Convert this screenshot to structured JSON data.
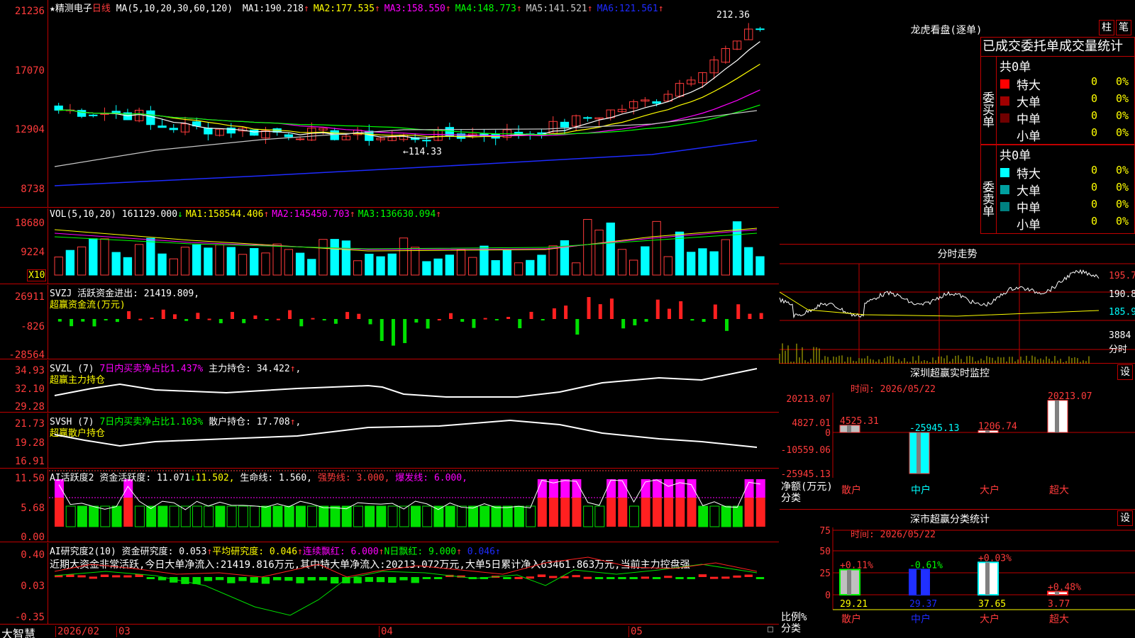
{
  "app": {
    "brand": "大智慧",
    "title": "精测电子",
    "period": "日线",
    "title_star": "★"
  },
  "colors": {
    "red": "#ff3b3b",
    "cyan": "#00ffff",
    "green": "#00ff00",
    "yellow": "#ffff00",
    "magenta": "#ff00ff",
    "blue": "#1e2bff",
    "grid": "#c00000",
    "white": "#ffffff"
  },
  "main": {
    "ma_label": "MA(5,10,20,30,60,120)",
    "ma": [
      {
        "name": "MA1:",
        "value": "190.218",
        "arrow": "↑",
        "color": "#ffffff"
      },
      {
        "name": "MA2:",
        "value": "177.535",
        "arrow": "↑",
        "color": "#ffff00"
      },
      {
        "name": "MA3:",
        "value": "158.550",
        "arrow": "↑",
        "color": "#ff00ff"
      },
      {
        "name": "MA4:",
        "value": "148.773",
        "arrow": "↑",
        "color": "#00ff00"
      },
      {
        "name": "MA5:",
        "value": "141.521",
        "arrow": "↑",
        "color": "#c8c8c8"
      },
      {
        "name": "MA6:",
        "value": "121.561",
        "arrow": "↑",
        "color": "#1e2bff"
      }
    ],
    "y_ticks": [
      "21236",
      "17070",
      "12904",
      "8738"
    ],
    "high_label": "212.36",
    "low_label": "←114.33"
  },
  "vol": {
    "label": "VOL(5,10,20)",
    "value": "161129.000",
    "arrow": "↓",
    "ma": [
      {
        "name": "MA1:",
        "value": "158544.406",
        "arrow": "↑",
        "color": "#ffff00"
      },
      {
        "name": "MA2:",
        "value": "145450.703",
        "arrow": "↑",
        "color": "#ff00ff"
      },
      {
        "name": "MA3:",
        "value": "136630.094",
        "arrow": "↑",
        "color": "#00ff00"
      }
    ],
    "y_ticks": [
      "18680",
      "9224"
    ],
    "unit": "X10"
  },
  "svzj": {
    "label": "SVZJ",
    "desc": "活跃资金进出:",
    "value": "21419.809",
    "sep": ",",
    "sub": "超赢资金流(万元)",
    "y_ticks": [
      "26911",
      "-826",
      "-28564"
    ]
  },
  "svzl": {
    "label": "SVZL (7)",
    "desc": "7日内买卖净占比1.437%",
    "desc2": "主力持仓:",
    "value": "34.422",
    "arrow": "↑",
    "sep": ",",
    "sub": "超赢主力持仓",
    "y_ticks": [
      "34.93",
      "32.10",
      "29.28"
    ]
  },
  "svsh": {
    "label": "SVSH (7)",
    "desc": "7日内买卖净占比1.103%",
    "desc2": "散户持仓:",
    "value": "17.708",
    "arrow": "↑",
    "sep": ",",
    "sub": "超赢散户持仓",
    "y_ticks": [
      "21.73",
      "19.28",
      "16.91"
    ]
  },
  "ai1": {
    "label": "AI活跃度2",
    "desc": "资金活跃度:",
    "value": "11.071",
    "arrow": "↓",
    "v2": "11.502,",
    "life": "生命线: 1.560,",
    "strong": "强势线: 3.000,",
    "burst": "爆发线: 6.000,",
    "y_ticks": [
      "11.50",
      "5.68",
      "0.00"
    ]
  },
  "ai2": {
    "label": "AI研究度2(10)",
    "desc": "资金研究度:",
    "value": "0.053",
    "arrow": "↑",
    "avg": "平均研究度: 0.046",
    "lh": "连续飘红: 6.000",
    "nh": "N日飘红: 9.000",
    "last": "0.046",
    "text": "近期大资金非常活跃,今日大单净流入:21419.816万元,其中特大单净流入:20213.072万元,大单5日累计净入63461.863万元,当前主力控盘强",
    "y_ticks": [
      "0.40",
      "0.03",
      "-0.35"
    ]
  },
  "xaxis": [
    "2026/02",
    "03",
    "04",
    "05"
  ],
  "lhb": {
    "title": "龙虎看盘(逐单)",
    "btn_bar": "柱",
    "btn_pen": "笔",
    "header": "已成交委托单成交量统计",
    "buy": {
      "side": "委买单",
      "total": "共0单",
      "rows": [
        {
          "name": "特大",
          "count": "0",
          "pct": "0%",
          "color": "#ff0000"
        },
        {
          "name": "大单",
          "count": "0",
          "pct": "0%",
          "color": "#a00000"
        },
        {
          "name": "中单",
          "count": "0",
          "pct": "0%",
          "color": "#700000"
        },
        {
          "name": "小单",
          "count": "0",
          "pct": "0%",
          "color": ""
        }
      ]
    },
    "sell": {
      "side": "委卖单",
      "total": "共0单",
      "rows": [
        {
          "name": "特大",
          "count": "0",
          "pct": "0%",
          "color": "#00ffff"
        },
        {
          "name": "大单",
          "count": "0",
          "pct": "0%",
          "color": "#00a0a0"
        },
        {
          "name": "中单",
          "count": "0",
          "pct": "0%",
          "color": "#008080"
        },
        {
          "name": "小单",
          "count": "0",
          "pct": "0%",
          "color": ""
        }
      ]
    }
  },
  "fs": {
    "title": "分时走势",
    "y": [
      "195.7",
      "190.8",
      "185.9",
      "3884",
      "分时"
    ]
  },
  "sz1": {
    "title": "深圳超赢实时监控",
    "btn": "设",
    "time": "时间: 2026/05/22",
    "y": [
      "20213.07",
      "4827.01",
      "0",
      "-10559.06",
      "-25945.13"
    ],
    "ylabel1": "净额(万元)",
    "ylabel2": "分类",
    "cats": [
      "散户",
      "中户",
      "大户",
      "超大"
    ],
    "vals": [
      "4525.31",
      "-25945.13",
      "1206.74",
      "20213.07"
    ]
  },
  "sz2": {
    "title": "深市超赢分类统计",
    "btn": "设",
    "time": "时间: 2026/05/22",
    "y": [
      "75",
      "50",
      "25",
      "0"
    ],
    "ylabel1": "比例%",
    "ylabel2": "分类",
    "cats": [
      "散户",
      "中户",
      "大户",
      "超大"
    ],
    "pcts": [
      "+0.11%",
      "-0.61%",
      "+0.03%",
      "+0.48%"
    ],
    "vals": [
      "29.21",
      "29.37",
      "37.65",
      "3.77"
    ]
  }
}
